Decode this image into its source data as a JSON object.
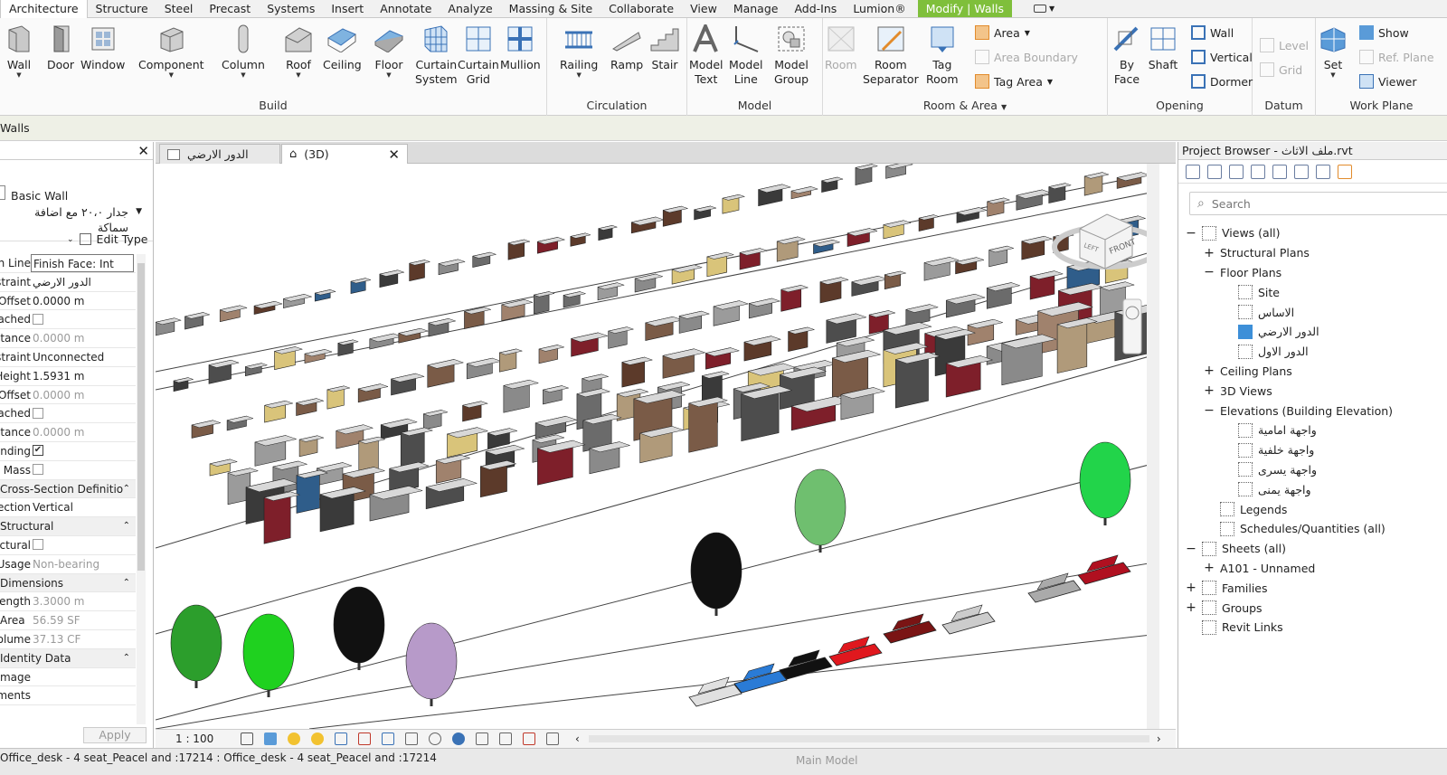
{
  "tabs": [
    {
      "label": "Architecture",
      "active": true
    },
    {
      "label": "Structure"
    },
    {
      "label": "Steel"
    },
    {
      "label": "Precast"
    },
    {
      "label": "Systems"
    },
    {
      "label": "Insert"
    },
    {
      "label": "Annotate"
    },
    {
      "label": "Analyze"
    },
    {
      "label": "Massing & Site"
    },
    {
      "label": "Collaborate"
    },
    {
      "label": "View"
    },
    {
      "label": "Manage"
    },
    {
      "label": "Add-Ins"
    },
    {
      "label": "Lumion®"
    },
    {
      "label": "Modify | Walls",
      "contextual": true
    }
  ],
  "ribbon": {
    "build": {
      "title": "Build",
      "wall": "Wall",
      "door": "Door",
      "window": "Window",
      "component": "Component",
      "column": "Column",
      "roof": "Roof",
      "ceiling": "Ceiling",
      "floor": "Floor",
      "curtain_system_1": "Curtain",
      "curtain_system_2": "System",
      "curtain_grid_1": "Curtain",
      "curtain_grid_2": "Grid",
      "mullion": "Mullion"
    },
    "circulation": {
      "title": "Circulation",
      "railing": "Railing",
      "ramp": "Ramp",
      "stair": "Stair"
    },
    "model": {
      "title": "Model",
      "model_text_1": "Model",
      "model_text_2": "Text",
      "model_line_1": "Model",
      "model_line_2": "Line",
      "model_group_1": "Model",
      "model_group_2": "Group"
    },
    "room_area": {
      "title": "Room & Area",
      "room": "Room",
      "room_sep_1": "Room",
      "room_sep_2": "Separator",
      "tag_room_1": "Tag",
      "tag_room_2": "Room",
      "area": "Area",
      "area_boundary": "Area  Boundary",
      "tag_area": "Tag  Area"
    },
    "opening": {
      "title": "Opening",
      "by_face_1": "By",
      "by_face_2": "Face",
      "shaft": "Shaft",
      "wall": "Wall",
      "vertical": "Vertical",
      "dormer": "Dormer"
    },
    "datum": {
      "title": "Datum",
      "level": "Level",
      "grid": "Grid"
    },
    "work_plane": {
      "title": "Work Plane",
      "set": "Set",
      "show": "Show",
      "ref_plane": "Ref. Plane",
      "viewer": "Viewer"
    }
  },
  "modbar": {
    "label": "Walls"
  },
  "properties": {
    "type_family": "Basic Wall",
    "type_name": "جدار ٢٠،٠ مع اضافة سماكة",
    "edit_type": "Edit Type",
    "rows": [
      {
        "label": "Location Line",
        "value": "Finish Face: Int",
        "input": true
      },
      {
        "label": "Base Constraint",
        "value": "الدور الارضي"
      },
      {
        "label": "Base Offset",
        "value": "0.0000 m"
      },
      {
        "label": "Base is Attached",
        "check": false
      },
      {
        "label": "Base Extension Distance",
        "value": "0.0000 m",
        "gray": true
      },
      {
        "label": "Top Constraint",
        "value": "Unconnected"
      },
      {
        "label": "Unconnected Height",
        "value": "1.5931 m"
      },
      {
        "label": "Top Offset",
        "value": "0.0000 m",
        "gray": true
      },
      {
        "label": "Top is Attached",
        "check": false
      },
      {
        "label": "Top Extension Distance",
        "value": "0.0000 m",
        "gray": true
      },
      {
        "label": "Room Bounding",
        "check": true
      },
      {
        "label": "Related to Mass",
        "check": false
      },
      {
        "label": "Cross-Section Definition",
        "section": true
      },
      {
        "label": "Cross-Section",
        "value": "Vertical"
      },
      {
        "label": "Structural",
        "section": true
      },
      {
        "label": "Structural",
        "check": false
      },
      {
        "label": "Structural Usage",
        "value": "Non-bearing",
        "gray": true
      },
      {
        "label": "Dimensions",
        "section": true
      },
      {
        "label": "Length",
        "value": "3.3000 m",
        "gray": true
      },
      {
        "label": "Area",
        "value": "56.59 SF",
        "gray": true
      },
      {
        "label": "Volume",
        "value": "37.13 CF",
        "gray": true
      },
      {
        "label": "Identity Data",
        "section": true
      },
      {
        "label": "Image",
        "value": ""
      },
      {
        "label": "Comments",
        "value": ""
      }
    ],
    "apply": "Apply"
  },
  "view": {
    "tab1": "الدور الارضي",
    "tab2": "(3D)",
    "viewcube_label": "FRONT",
    "viewcube_side": "LEFT",
    "scale": "1 : 100"
  },
  "project_browser": {
    "title": "Project Browser - ملف الاثاث.rvt",
    "search_placeholder": "Search",
    "tree": [
      {
        "label": "Views (all)",
        "exp": "−",
        "lvl": 0,
        "icon": true
      },
      {
        "label": "Structural Plans",
        "exp": "+",
        "lvl": 1
      },
      {
        "label": "Floor Plans",
        "exp": "−",
        "lvl": 1
      },
      {
        "label": "Site",
        "lvl": 2,
        "icon": true
      },
      {
        "label": "الاساس",
        "lvl": 2,
        "icon": true,
        "rtl": true
      },
      {
        "label": "الدور الارضي",
        "lvl": 2,
        "icon": true,
        "sel": true,
        "rtl": true
      },
      {
        "label": "الدور الاول",
        "lvl": 2,
        "icon": true,
        "rtl": true
      },
      {
        "label": "Ceiling Plans",
        "exp": "+",
        "lvl": 1
      },
      {
        "label": "3D Views",
        "exp": "+",
        "lvl": 1
      },
      {
        "label": "Elevations (Building Elevation)",
        "exp": "−",
        "lvl": 1
      },
      {
        "label": "واجهة امامية",
        "lvl": 2,
        "icon": true,
        "rtl": true
      },
      {
        "label": "واجهة خلفية",
        "lvl": 2,
        "icon": true,
        "rtl": true
      },
      {
        "label": "واجهة يسرى",
        "lvl": 2,
        "icon": true,
        "rtl": true
      },
      {
        "label": "واجهة يمنى",
        "lvl": 2,
        "icon": true,
        "rtl": true
      },
      {
        "label": "Legends",
        "lvl": 1,
        "icon": true
      },
      {
        "label": "Schedules/Quantities (all)",
        "lvl": 1,
        "icon": true
      },
      {
        "label": "Sheets (all)",
        "exp": "−",
        "lvl": 0,
        "icon": true
      },
      {
        "label": "A101 - Unnamed",
        "exp": "+",
        "lvl": 1
      },
      {
        "label": "Families",
        "exp": "+",
        "lvl": 0,
        "icon": true
      },
      {
        "label": "Groups",
        "exp": "+",
        "lvl": 0,
        "icon": true
      },
      {
        "label": "Revit Links",
        "lvl": 0,
        "icon": true
      }
    ]
  },
  "status": {
    "text": "Office_desk - 4 seat_Peacel and :17214 : Office_desk - 4 seat_Peacel and :17214",
    "main_model": "Main Model"
  },
  "colors": {
    "contextual_tab": "#7fbf3b",
    "selected": "#3d8fd8",
    "icon_blue": "#3a72b6"
  }
}
